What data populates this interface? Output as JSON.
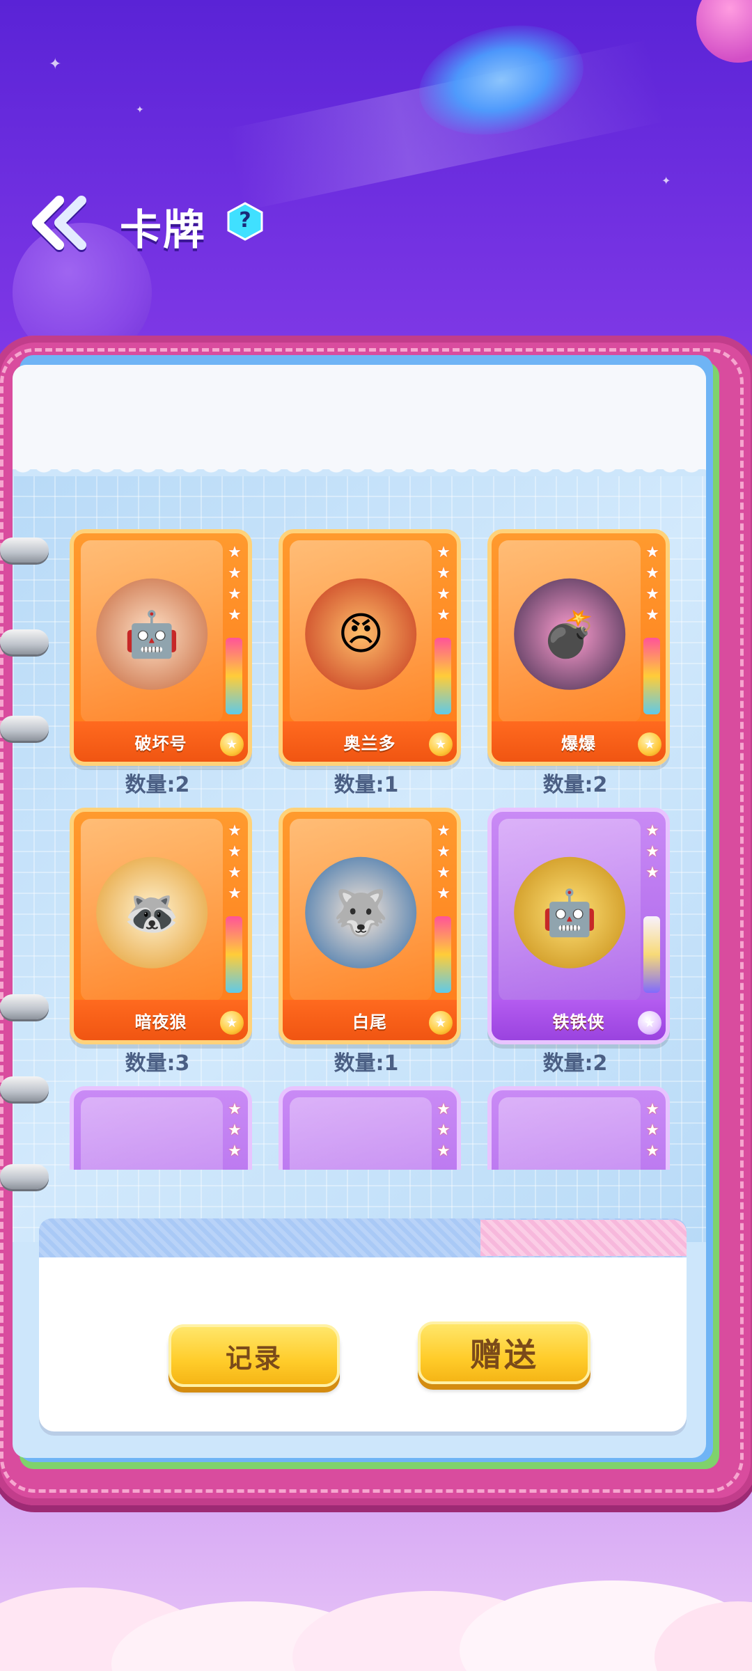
{
  "header": {
    "title": "卡牌",
    "help_label": "?"
  },
  "cards": [
    {
      "name": "破坏号",
      "count": "数量:2",
      "color": "orange",
      "icon": "robot-ship"
    },
    {
      "name": "奥兰多",
      "count": "数量:1",
      "color": "orange",
      "icon": "fire-beard-warrior"
    },
    {
      "name": "爆爆",
      "count": "数量:2",
      "color": "orange",
      "icon": "bomb-monster"
    },
    {
      "name": "暗夜狼",
      "count": "数量:3",
      "color": "orange",
      "icon": "masked-raccoon"
    },
    {
      "name": "白尾",
      "count": "数量:1",
      "color": "orange",
      "icon": "blue-wolf"
    },
    {
      "name": "铁铁侠",
      "count": "数量:2",
      "color": "purple",
      "icon": "yellow-robot"
    },
    {
      "name": "",
      "count": "",
      "color": "purple",
      "icon": "helmet-knight"
    },
    {
      "name": "",
      "count": "",
      "color": "purple",
      "icon": "shadow-hood"
    },
    {
      "name": "",
      "count": "",
      "color": "purple",
      "icon": "green-monster"
    }
  ],
  "buttons": {
    "record": "记录",
    "gift": "赠送"
  }
}
